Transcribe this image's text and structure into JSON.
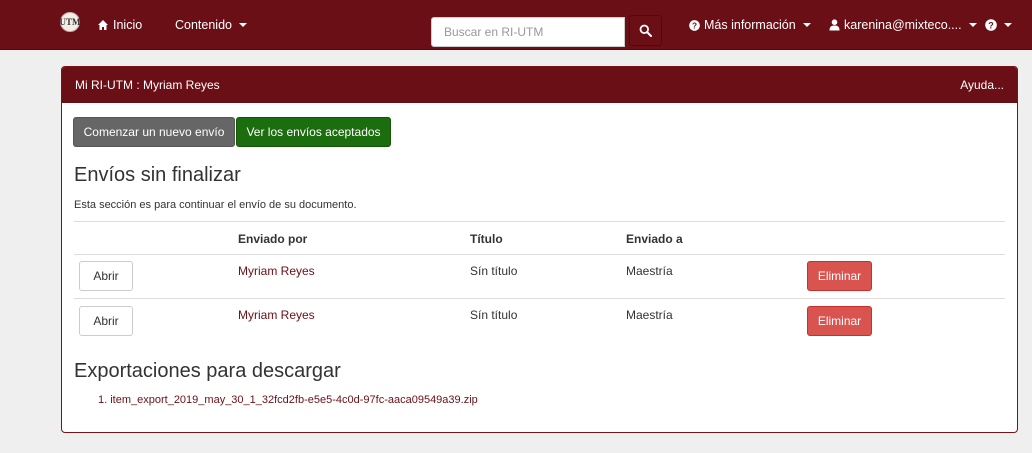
{
  "navbar": {
    "logo_text": "UTM",
    "home_label": "Inicio",
    "content_label": "Contenido",
    "search_placeholder": "Buscar en RI-UTM",
    "more_info_label": "Más información",
    "user_label": "karenina@mixteco.... "
  },
  "panel": {
    "heading": "Mi RI-UTM : Myriam Reyes",
    "help_label": "Ayuda..."
  },
  "actions": {
    "new_submission": "Comenzar un nuevo envío",
    "accepted_submissions": "Ver los envíos aceptados"
  },
  "unfinished": {
    "title": "Envíos sin finalizar",
    "description": "Esta sección es para continuar el envío de su documento.",
    "columns": [
      "Enviado por",
      "Título",
      "Enviado a"
    ],
    "rows": [
      {
        "open_label": "Abrir",
        "submitter": "Myriam Reyes",
        "title": "Sín título",
        "collection": "Maestría",
        "delete_label": "Eliminar"
      },
      {
        "open_label": "Abrir",
        "submitter": "Myriam Reyes",
        "title": "Sín título",
        "collection": "Maestría",
        "delete_label": "Eliminar"
      }
    ]
  },
  "exports": {
    "title": "Exportaciones para descargar",
    "items": [
      "1. item_export_2019_may_30_1_32fcd2fb-e5e5-4c0d-97fc-aaca09549a39.zip"
    ]
  },
  "colors": {
    "brand": "#6b0f16",
    "success": "#1b6d0e",
    "danger": "#d9534f",
    "neutral_button": "#666666"
  },
  "icons": {
    "home": "home-icon",
    "search": "search-icon",
    "info": "info-circle-icon",
    "user": "user-icon",
    "help": "question-circle-icon",
    "caret": "caret-down-icon"
  }
}
